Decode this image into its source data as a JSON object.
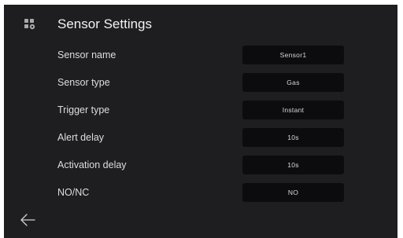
{
  "header": {
    "icon": "settings-grid-icon",
    "title": "Sensor Settings"
  },
  "settings": [
    {
      "label": "Sensor name",
      "value": "Sensor1"
    },
    {
      "label": "Sensor type",
      "value": "Gas"
    },
    {
      "label": "Trigger type",
      "value": "Instant"
    },
    {
      "label": "Alert delay",
      "value": "10s"
    },
    {
      "label": "Activation delay",
      "value": "10s"
    },
    {
      "label": "NO/NC",
      "value": "NO"
    }
  ],
  "footer": {
    "back_icon": "arrow-left-icon"
  },
  "colors": {
    "background": "#1e1e21",
    "field": "#0c0c0e",
    "text": "#e6e6e6"
  }
}
